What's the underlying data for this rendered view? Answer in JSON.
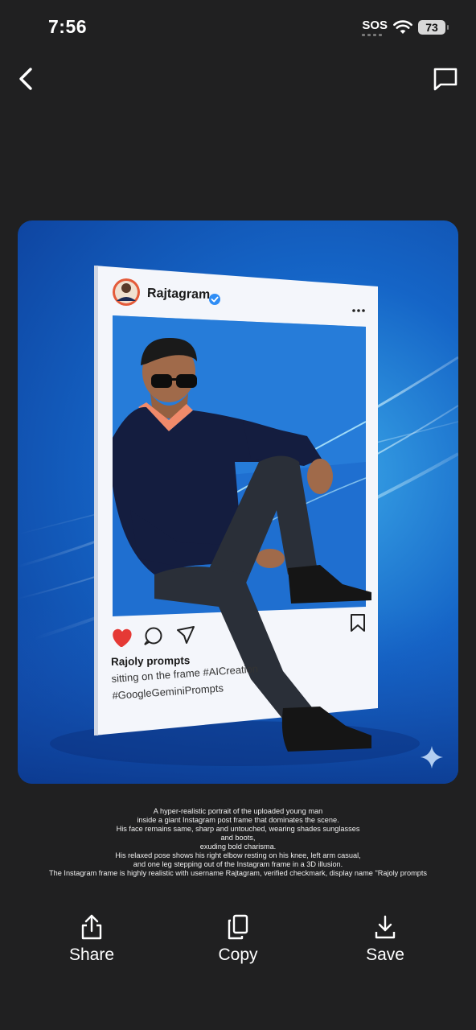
{
  "status_bar": {
    "time": "7:56",
    "carrier_text": "SOS",
    "battery_percent": "73"
  },
  "image": {
    "post_username": "Rajtagram",
    "post_display_name": "Rajoly prompts",
    "post_caption_line1": "sitting on the frame #AICreation",
    "post_caption_line2": "#GoogleGeminiPrompts"
  },
  "prompt_text": "A hyper-realistic portrait of the uploaded young man\ninside a giant Instagram post frame that dominates the scene.\nHis face remains same, sharp and untouched, wearing shades sunglasses\nand boots,\nexuding bold charisma.\nHis relaxed pose shows his right elbow resting on his knee, left arm casual,\nand one leg stepping out of the Instagram frame in a 3D illusion.\nThe Instagram frame is highly realistic with username Rajtagram, verified checkmark, display name \"Rajoly prompts",
  "actions": {
    "share": "Share",
    "copy": "Copy",
    "save": "Save"
  },
  "icons": {
    "back": "chevron-left-icon",
    "comment": "comment-icon",
    "share": "share-icon",
    "copy": "copy-icon",
    "save": "download-icon",
    "sparkle": "sparkle-icon"
  },
  "colors": {
    "background": "#202021",
    "text": "#ffffff",
    "like": "#e53935",
    "verified": "#2f8df5"
  }
}
